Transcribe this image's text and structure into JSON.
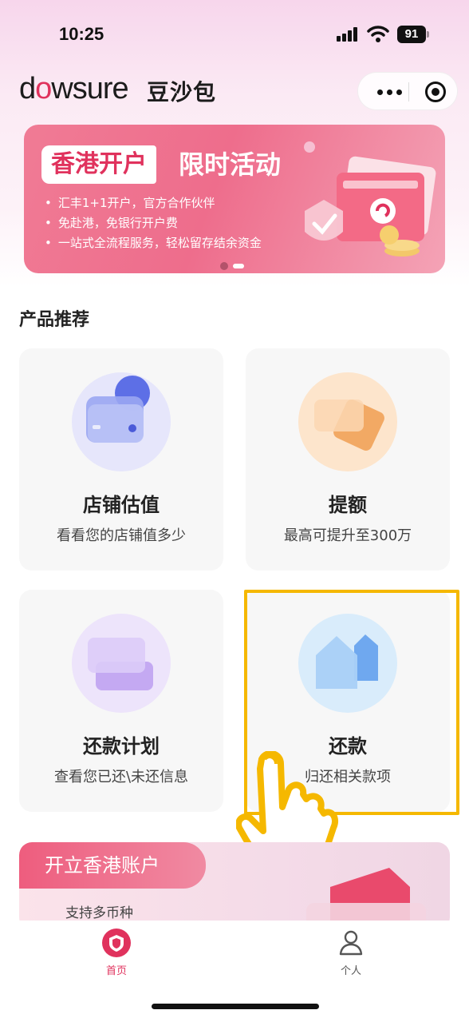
{
  "status_bar": {
    "time": "10:25",
    "battery": "91"
  },
  "header": {
    "logo_prefix": "d",
    "logo_o": "o",
    "logo_suffix": "wsure",
    "logo_cn": "豆沙包"
  },
  "banner": {
    "tag": "香港开户",
    "title": "限时活动",
    "bullets": [
      "汇丰1+1开户，官方合作伙伴",
      "免赴港，免银行开户费",
      "一站式全流程服务，轻松留存结余资金"
    ]
  },
  "section_title": "产品推荐",
  "cards": [
    {
      "name": "店铺估值",
      "desc": "看看您的店铺值多少"
    },
    {
      "name": "提额",
      "desc": "最高可提升至300万"
    },
    {
      "name": "还款计划",
      "desc": "查看您已还\\未还信息"
    },
    {
      "name": "还款",
      "desc": "归还相关款项"
    }
  ],
  "account_card": {
    "title": "开立香港账户",
    "subtitle": "支持多币种"
  },
  "tabbar": {
    "home": "首页",
    "me": "个人"
  },
  "colors": {
    "accent": "#e0325d",
    "highlight": "#f5b800"
  }
}
